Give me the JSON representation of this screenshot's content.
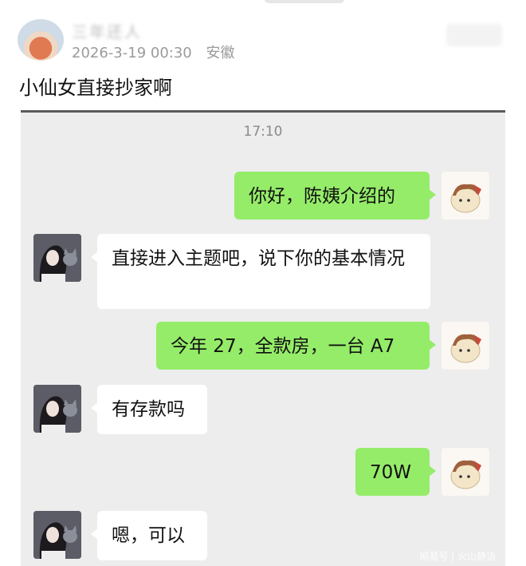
{
  "post": {
    "author_name": "三年还人",
    "date": "2026-3-19 00:30",
    "location": "安徽",
    "caption": "小仙女直接抄家啊"
  },
  "chat": {
    "timestamp": "17:10",
    "messages": [
      {
        "from": "me",
        "text": "你好，陈姨介绍的"
      },
      {
        "from": "her",
        "text": "直接进入主题吧，说下你的基本情况"
      },
      {
        "from": "me",
        "text": "今年 27，全款房，一台 A7"
      },
      {
        "from": "her",
        "text": "有存款吗"
      },
      {
        "from": "me",
        "text": "70W"
      },
      {
        "from": "her",
        "text": "嗯，可以"
      }
    ]
  },
  "watermark": "网易号 | 火山静话",
  "colors": {
    "my_bubble": "#95ec69",
    "her_bubble": "#ffffff",
    "chat_background": "#ededed"
  }
}
